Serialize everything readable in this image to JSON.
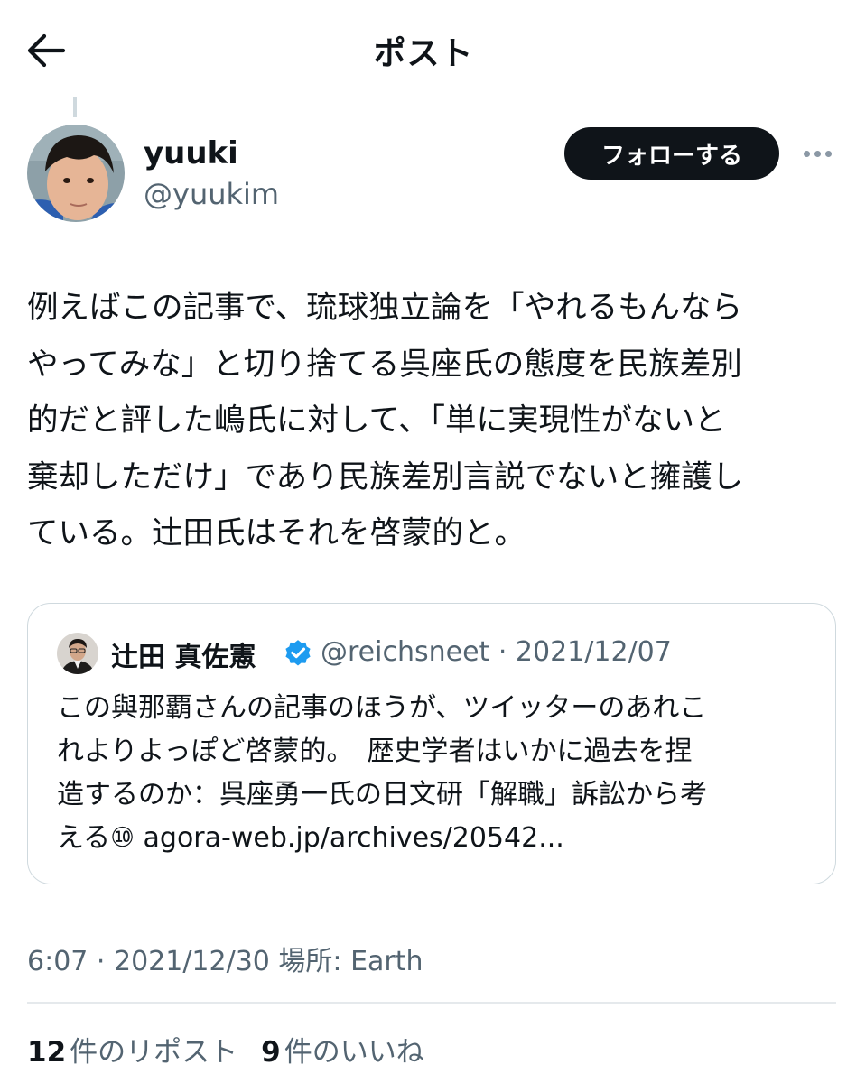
{
  "header": {
    "title": "ポスト",
    "back_icon": "arrow-left-icon"
  },
  "post": {
    "display_name": "yuuki",
    "handle": "@yuukim",
    "follow_label": "フォローする",
    "more_icon": "more-horizontal-icon",
    "text_lines": [
      "例えばこの記事で、琉球独立論を「やれるもんなら",
      "やってみな」と切り捨てる呉座氏の態度を民族差別",
      "的だと評した嶋氏に対して、「単に実現性がないと",
      "棄却しただけ」であり民族差別言説でないと擁護し",
      "ている。辻田氏はそれを啓蒙的と。"
    ],
    "timestamp": "6:07 · 2021/12/30 場所: Earth"
  },
  "quote": {
    "name": "辻田 真佐憲",
    "verified_icon": "verified-badge-icon",
    "meta": "@reichsneet · 2021/12/07",
    "text_lines": [
      "この與那覇さんの記事のほうが、ツイッターのあれこ",
      "れよりよっぽど啓蒙的。　歴史学者はいかに過去を捏",
      "造するのか：呉座勇一氏の日文研「解職」訴訟から考",
      "える⑩ agora-web.jp/archives/20542..."
    ]
  },
  "stats": {
    "reposts_count": "12",
    "reposts_label": "件のリポスト",
    "likes_count": "9",
    "likes_label": "件のいいね"
  },
  "colors": {
    "text": "#0f1419",
    "secondary": "#536471",
    "border": "#cfd9de",
    "verified": "#1d9bf0"
  }
}
